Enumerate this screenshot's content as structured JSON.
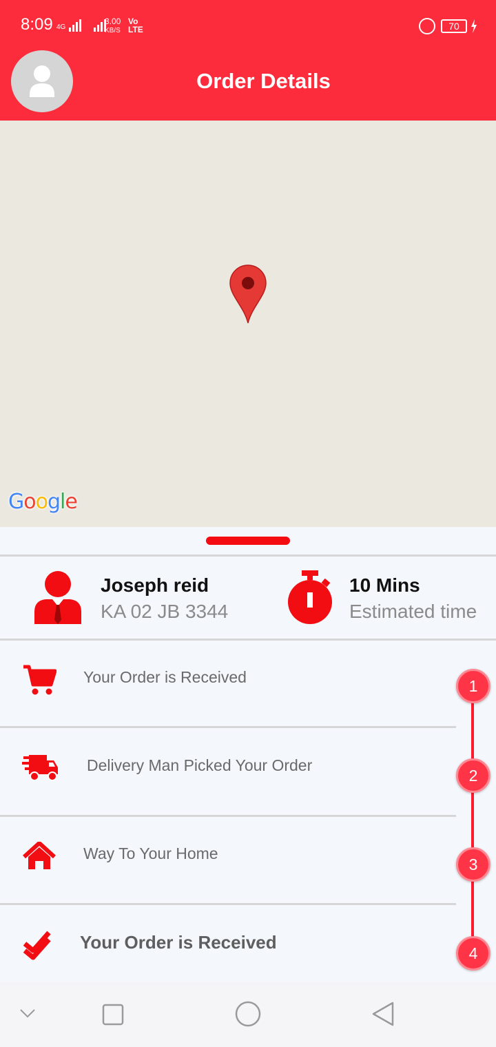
{
  "status_bar": {
    "time": "8:09",
    "network": "4G",
    "speed": "3.00",
    "speed_unit": "KB/S",
    "volte": "Vo LTE",
    "battery": "70"
  },
  "header": {
    "title": "Order Details"
  },
  "map": {
    "attribution": "Google"
  },
  "driver": {
    "name": "Joseph reid",
    "vehicle": "KA 02 JB 3344"
  },
  "eta": {
    "value": "10 Mins",
    "label": "Estimated time"
  },
  "steps": [
    {
      "icon": "cart-icon",
      "label": "Your Order is Received",
      "number": "1"
    },
    {
      "icon": "delivery-truck-icon",
      "label": "Delivery Man Picked Your Order",
      "number": "2"
    },
    {
      "icon": "home-icon",
      "label": "Way To Your Home",
      "number": "3"
    },
    {
      "icon": "double-check-icon",
      "label": "Your Order is Received",
      "number": "4"
    }
  ],
  "colors": {
    "primary": "#fc2c3c",
    "accent": "#f50b12",
    "map_background": "#ebe8e0",
    "background": "#f4f7fc"
  },
  "nav": {
    "buttons": [
      "chevron-down-icon",
      "recent-apps-icon",
      "home-button-icon",
      "back-icon"
    ]
  }
}
